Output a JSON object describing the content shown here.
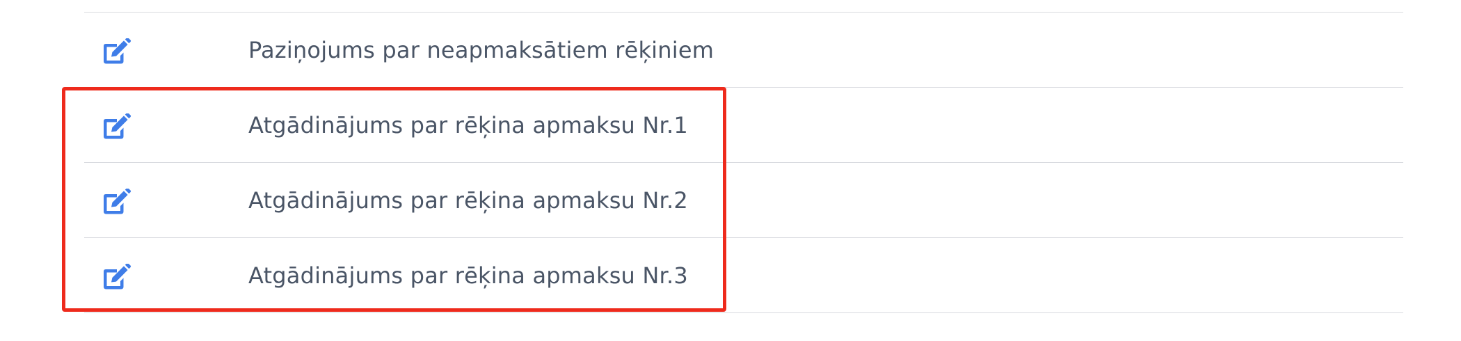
{
  "colors": {
    "icon": "#3f7de8",
    "text": "#4a5566",
    "divider": "#d9dbe0",
    "highlight": "#ee2a1c"
  },
  "list": {
    "items": [
      {
        "icon": "edit-icon",
        "label": "Paziņojums par neapmaksātiem rēķiniem"
      },
      {
        "icon": "edit-icon",
        "label": "Atgādinājums par rēķina apmaksu Nr.1"
      },
      {
        "icon": "edit-icon",
        "label": "Atgādinājums par rēķina apmaksu Nr.2"
      },
      {
        "icon": "edit-icon",
        "label": "Atgādinājums par rēķina apmaksu Nr.3"
      }
    ]
  }
}
